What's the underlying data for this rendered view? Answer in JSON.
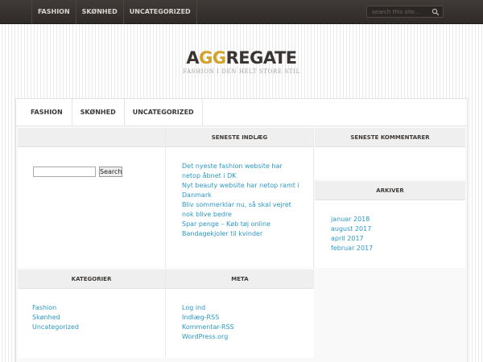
{
  "top_nav": [
    "FASHION",
    "SKØNHED",
    "UNCATEGORIZED"
  ],
  "top_search": {
    "placeholder": "search this site...",
    "icon": "search-icon"
  },
  "logo": {
    "part1": "A",
    "part2": "GG",
    "part3": "REGATE",
    "tagline": "FASHION I DEN HELT STORE STIL"
  },
  "main_nav": [
    "FASHION",
    "SKØNHED",
    "UNCATEGORIZED"
  ],
  "widgets": {
    "search": {
      "button_label": "Search",
      "value": ""
    },
    "recent_posts": {
      "title": "SENESTE INDLÆG",
      "items": [
        "Det nyeste fashion website har netop åbnet i DK",
        "Nyt beauty website har netop ramt i Danmark",
        "Bliv sommerklar nu, så skal vejret nok blive bedre",
        "Spar penge – Køb tøj online",
        "Bandagekjoler til kvinder"
      ]
    },
    "recent_comments": {
      "title": "SENESTE KOMMENTARER"
    },
    "archive": {
      "title": "ARKIVER",
      "items": [
        "januar 2018",
        "august 2017",
        "april 2017",
        "februar 2017"
      ]
    },
    "categories": {
      "title": "KATEGORIER",
      "items": [
        "Fashion",
        "Skønhed",
        "Uncategorized"
      ]
    },
    "meta": {
      "title": "META",
      "items": [
        "Log ind",
        "Indlæg-RSS",
        "Kommentar-RSS",
        "WordPress.org"
      ]
    }
  },
  "colors": {
    "link": "#2c98c4",
    "topbar": "#3a3532",
    "logo_accent": "#d3a22b"
  }
}
